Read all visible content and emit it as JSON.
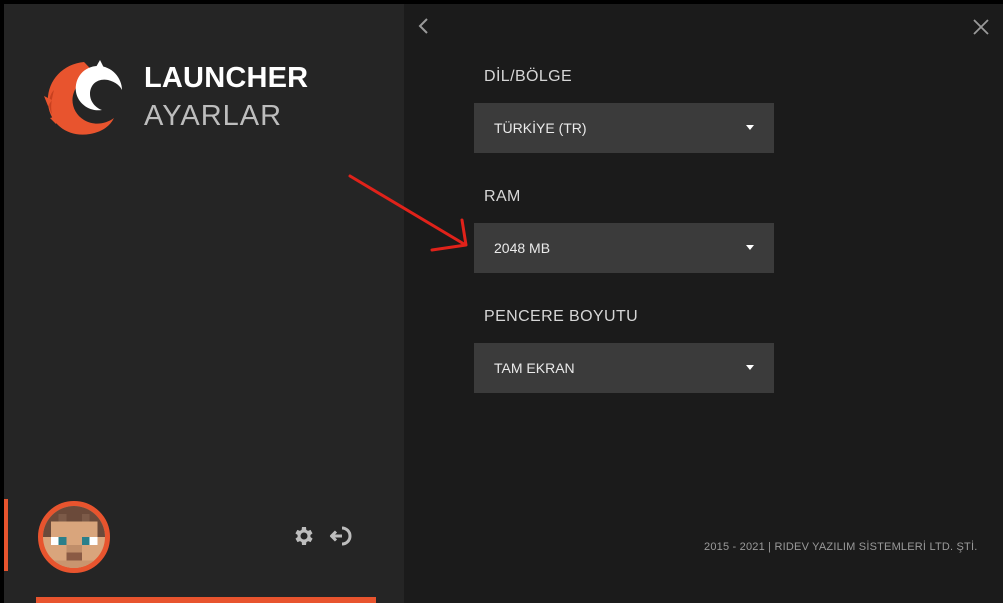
{
  "app": {
    "title": "LAUNCHER",
    "subtitle": "AYARLAR"
  },
  "sidebar": {
    "avatar": "avatar",
    "settings_icon": "gear-icon",
    "logout_icon": "logout-icon"
  },
  "settings": {
    "language": {
      "label": "DİL/BÖLGE",
      "value": "TÜRKİYE (TR)"
    },
    "ram": {
      "label": "RAM",
      "value": "2048 MB"
    },
    "window_size": {
      "label": "PENCERE BOYUTU",
      "value": "TAM EKRAN"
    }
  },
  "footer": {
    "copyright": "2015 - 2021 | RIDEV YAZILIM SİSTEMLERİ LTD. ŞTİ."
  },
  "colors": {
    "accent": "#e8542e",
    "sidebar_bg": "#252525",
    "main_bg": "#1b1b1b",
    "select_bg": "#3b3b3b",
    "annotation_arrow": "#e0221a"
  }
}
